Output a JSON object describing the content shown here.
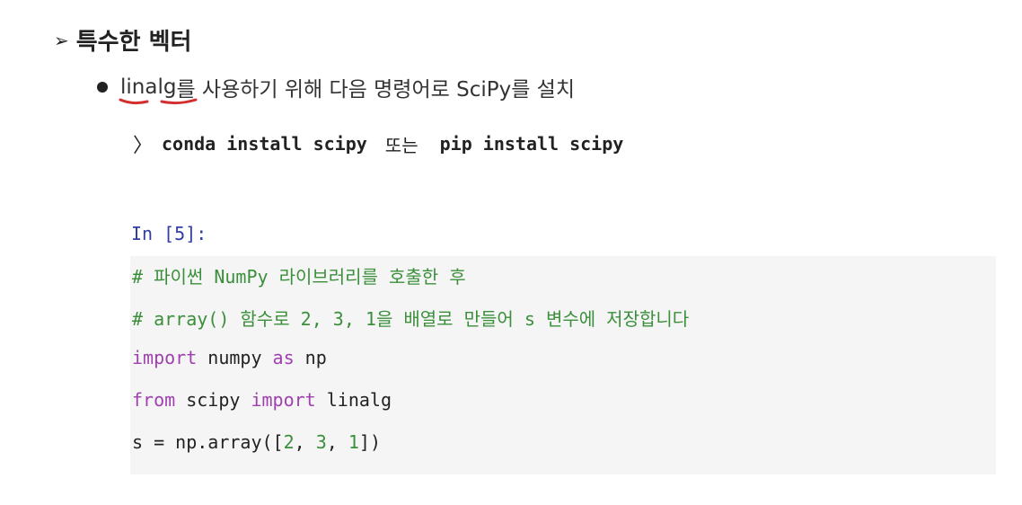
{
  "heading": {
    "arrow": "➢",
    "title": "특수한 벡터"
  },
  "bullet": {
    "underlined_word": "linalg",
    "text": "를 사용하기 위해 다음 명령어로 SciPy를 설치"
  },
  "install": {
    "prompt_glyph": "〉",
    "cmd1": "conda install scipy",
    "separator": "또는",
    "cmd2": "pip install scipy"
  },
  "cell": {
    "prompt": "In [5]:",
    "comment1": "# 파이썬 NumPy 라이브러리를 호출한 후",
    "comment2": "# array() 함수로 2, 3, 1을 배열로 만들어 s 변수에 저장합니다",
    "line3": {
      "kw_import": "import",
      "mid": " numpy ",
      "kw_as": "as",
      "end": " np"
    },
    "line4": {
      "kw_from": "from",
      "mid": " scipy ",
      "kw_import": "import",
      "end": " linalg"
    },
    "line5": {
      "start": "s = np.array([",
      "n1": "2",
      "c1": ", ",
      "n2": "3",
      "c2": ", ",
      "n3": "1",
      "end": "])"
    }
  },
  "colors": {
    "comment": "#3b8f3b",
    "keyword": "#a040b0",
    "prompt": "#303f9f",
    "underline": "#d32f2f",
    "cell_bg": "#f5f5f5"
  }
}
